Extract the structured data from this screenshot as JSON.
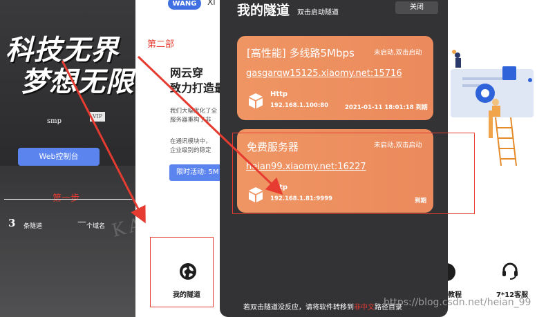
{
  "left_panel": {
    "slogan_line1": "科技无界",
    "slogan_line2": "梦想无限",
    "username": "smp",
    "vip_label": "VIP",
    "web_console_label": "Web控制台",
    "step1_label": "第一步",
    "tunnel_count": "3",
    "tunnel_count_label": "条隧道",
    "domain_count": "—",
    "domain_count_label": "个域名",
    "watermark_text": "KAKASHI"
  },
  "page": {
    "brand": "WANG",
    "brand_tail": "Xi",
    "step2_label": "第二部",
    "hero_title_line1": "网云穿",
    "hero_title_line2": "致力打造最",
    "para1": "我们大幅优化了全",
    "para2": "服务器重构了非",
    "para3": "在通讯模块中，",
    "para4": "企业级别的稳定",
    "promo_label": "限时活动: 5M",
    "nav": {
      "tunnel_label": "我的隧道",
      "tutorial_label": "教程",
      "service_label": "7*12客服"
    },
    "csdn_watermark": "https://blog.csdn.net/heian_99"
  },
  "drawer": {
    "title": "我的隧道",
    "subtitle": "双击启动隧道",
    "close_label": "关闭",
    "footer_prefix": "若双击隧道没反应，请将软件转移到",
    "footer_red": "非中文",
    "footer_suffix": "路径目录",
    "tunnels": [
      {
        "title": "[高性能] 多线路5Mbps",
        "status": "未启动,双击启动",
        "domain": "gasgarqw15125.xiaomy.net:15716",
        "protocol": "Http",
        "address": "192.168.1.100:80",
        "expires": "2021-01-11 18:01:18 到期"
      },
      {
        "title": "免费服务器",
        "status": "未启动,双击启动",
        "domain": "heian99.xiaomy.net:16227",
        "protocol": "Http",
        "address": "192.168.1.81:9999",
        "expires": "到期"
      }
    ]
  },
  "colors": {
    "accent_blue": "#5b84ee",
    "card_orange": "#ec8f5f",
    "annotation_red": "#e53b30",
    "drawer_bg": "#333336"
  }
}
